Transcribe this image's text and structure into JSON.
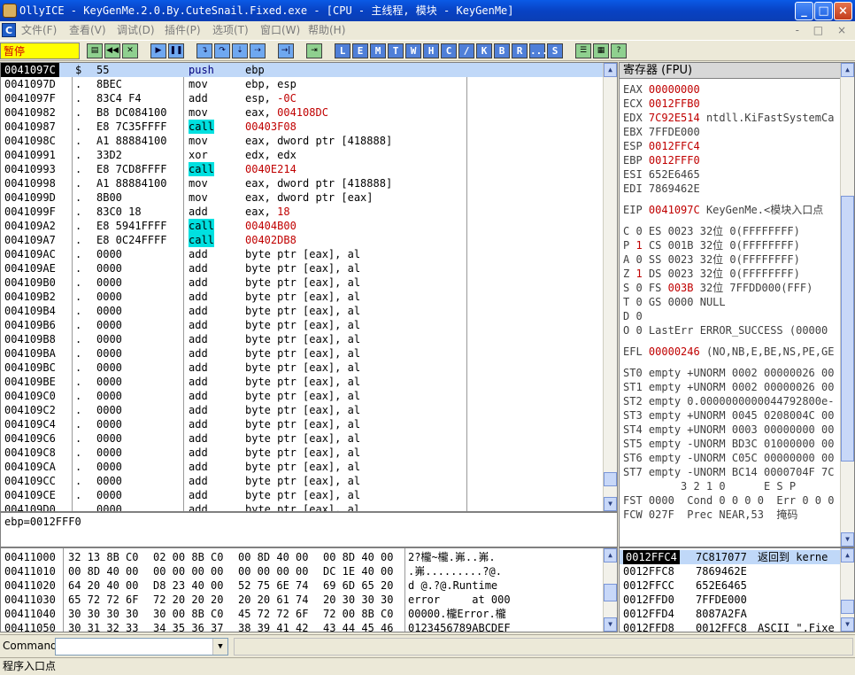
{
  "window": {
    "title": "OllyICE - KeyGenMe.2.0.By.CuteSnail.Fixed.exe - [CPU - 主线程, 模块 - KeyGenMe]",
    "controls": [
      "_",
      "□",
      "×"
    ]
  },
  "menu": {
    "icon": "C",
    "items": [
      "文件(F)",
      "查看(V)",
      "调试(D)",
      "插件(P)",
      "选项(T)",
      "窗口(W)",
      "帮助(H)"
    ],
    "mdi_controls": "- □ ×"
  },
  "toolbar": {
    "status": "暂停",
    "buttons": [
      "open",
      "rewind",
      "close",
      "run",
      "pause",
      "step-into",
      "step-over",
      "trace-into",
      "trace-over",
      "execute-till-return"
    ],
    "letters": [
      "L",
      "E",
      "M",
      "T",
      "W",
      "H",
      "C",
      "/",
      "K",
      "B",
      "R",
      "...",
      "S"
    ],
    "extra": [
      "list",
      "grid",
      "help"
    ],
    "help_label": "?"
  },
  "disasm": {
    "rows": [
      {
        "addr": "0041097C",
        "mark": "$",
        "hex": "55",
        "mn": "push",
        "op": "ebp",
        "sel": true
      },
      {
        "addr": "0041097D",
        "mark": ".",
        "hex": "8BEC",
        "mn": "mov",
        "op": "ebp, esp"
      },
      {
        "addr": "0041097F",
        "mark": ".",
        "hex": "83C4 F4",
        "mn": "add",
        "op": "esp, -0C",
        "opred": "-0C"
      },
      {
        "addr": "00410982",
        "mark": ".",
        "hex": "B8 DC084100",
        "mn": "mov",
        "op": "eax, 004108DC",
        "opred": "004108DC"
      },
      {
        "addr": "00410987",
        "mark": ".",
        "hex": "E8 7C35FFFF",
        "mn": "call",
        "op": "00403F08",
        "call": true
      },
      {
        "addr": "0041098C",
        "mark": ".",
        "hex": "A1 88884100",
        "mn": "mov",
        "op": "eax, dword ptr [418888]"
      },
      {
        "addr": "00410991",
        "mark": ".",
        "hex": "33D2",
        "mn": "xor",
        "op": "edx, edx"
      },
      {
        "addr": "00410993",
        "mark": ".",
        "hex": "E8 7CD8FFFF",
        "mn": "call",
        "op": "0040E214",
        "call": true
      },
      {
        "addr": "00410998",
        "mark": ".",
        "hex": "A1 88884100",
        "mn": "mov",
        "op": "eax, dword ptr [418888]"
      },
      {
        "addr": "0041099D",
        "mark": ".",
        "hex": "8B00",
        "mn": "mov",
        "op": "eax, dword ptr [eax]"
      },
      {
        "addr": "0041099F",
        "mark": ".",
        "hex": "83C0 18",
        "mn": "add",
        "op": "eax, 18",
        "opred": "18"
      },
      {
        "addr": "004109A2",
        "mark": ".",
        "hex": "E8 5941FFFF",
        "mn": "call",
        "op": "00404B00",
        "call": true
      },
      {
        "addr": "004109A7",
        "mark": ".",
        "hex": "E8 0C24FFFF",
        "mn": "call",
        "op": "00402DB8",
        "call": true
      },
      {
        "addr": "004109AC",
        "mark": ".",
        "hex": "0000",
        "mn": "add",
        "op": "byte ptr [eax], al"
      },
      {
        "addr": "004109AE",
        "mark": ".",
        "hex": "0000",
        "mn": "add",
        "op": "byte ptr [eax], al"
      },
      {
        "addr": "004109B0",
        "mark": ".",
        "hex": "0000",
        "mn": "add",
        "op": "byte ptr [eax], al"
      },
      {
        "addr": "004109B2",
        "mark": ".",
        "hex": "0000",
        "mn": "add",
        "op": "byte ptr [eax], al"
      },
      {
        "addr": "004109B4",
        "mark": ".",
        "hex": "0000",
        "mn": "add",
        "op": "byte ptr [eax], al"
      },
      {
        "addr": "004109B6",
        "mark": ".",
        "hex": "0000",
        "mn": "add",
        "op": "byte ptr [eax], al"
      },
      {
        "addr": "004109B8",
        "mark": ".",
        "hex": "0000",
        "mn": "add",
        "op": "byte ptr [eax], al"
      },
      {
        "addr": "004109BA",
        "mark": ".",
        "hex": "0000",
        "mn": "add",
        "op": "byte ptr [eax], al"
      },
      {
        "addr": "004109BC",
        "mark": ".",
        "hex": "0000",
        "mn": "add",
        "op": "byte ptr [eax], al"
      },
      {
        "addr": "004109BE",
        "mark": ".",
        "hex": "0000",
        "mn": "add",
        "op": "byte ptr [eax], al"
      },
      {
        "addr": "004109C0",
        "mark": ".",
        "hex": "0000",
        "mn": "add",
        "op": "byte ptr [eax], al"
      },
      {
        "addr": "004109C2",
        "mark": ".",
        "hex": "0000",
        "mn": "add",
        "op": "byte ptr [eax], al"
      },
      {
        "addr": "004109C4",
        "mark": ".",
        "hex": "0000",
        "mn": "add",
        "op": "byte ptr [eax], al"
      },
      {
        "addr": "004109C6",
        "mark": ".",
        "hex": "0000",
        "mn": "add",
        "op": "byte ptr [eax], al"
      },
      {
        "addr": "004109C8",
        "mark": ".",
        "hex": "0000",
        "mn": "add",
        "op": "byte ptr [eax], al"
      },
      {
        "addr": "004109CA",
        "mark": ".",
        "hex": "0000",
        "mn": "add",
        "op": "byte ptr [eax], al"
      },
      {
        "addr": "004109CC",
        "mark": ".",
        "hex": "0000",
        "mn": "add",
        "op": "byte ptr [eax], al"
      },
      {
        "addr": "004109CE",
        "mark": ".",
        "hex": "0000",
        "mn": "add",
        "op": "byte ptr [eax], al"
      },
      {
        "addr": "004109D0",
        "mark": ".",
        "hex": "0000",
        "mn": "add",
        "op": "byte ptr [eax], al"
      }
    ]
  },
  "info_text": "ebp=0012FFF0",
  "registers": {
    "header": "寄存器 (FPU)",
    "lines": [
      {
        "name": "EAX",
        "val": "00000000",
        "rest": "",
        "red": true
      },
      {
        "name": "ECX",
        "val": "0012FFB0",
        "rest": "",
        "red": true
      },
      {
        "name": "EDX",
        "val": "7C92E514",
        "rest": "ntdll.KiFastSystemCa",
        "red": true
      },
      {
        "name": "EBX",
        "val": "7FFDE000",
        "rest": "",
        "red": false
      },
      {
        "name": "ESP",
        "val": "0012FFC4",
        "rest": "",
        "red": true
      },
      {
        "name": "EBP",
        "val": "0012FFF0",
        "rest": "",
        "red": true
      },
      {
        "name": "ESI",
        "val": "652E6465",
        "rest": "",
        "red": false
      },
      {
        "name": "EDI",
        "val": "7869462E",
        "rest": "",
        "red": false
      },
      {
        "gap": true
      },
      {
        "name": "EIP",
        "val": "0041097C",
        "rest": "KeyGenMe.<模块入口点",
        "red": true
      },
      {
        "gap": true
      },
      {
        "name": "C 0",
        "val": "",
        "rest": "ES 0023 32位 0(FFFFFFFF)",
        "red": false
      },
      {
        "name": "P",
        "val": "1",
        "rest": "CS 001B 32位 0(FFFFFFFF)",
        "red": true
      },
      {
        "name": "A 0",
        "val": "",
        "rest": "SS 0023 32位 0(FFFFFFFF)",
        "red": false
      },
      {
        "name": "Z",
        "val": "1",
        "rest": "DS 0023 32位 0(FFFFFFFF)",
        "red": true
      },
      {
        "name": "S 0",
        "val": "",
        "rest": "FS 003B 32位 7FFDD000(FFF)",
        "red": false,
        "fsred": "003B"
      },
      {
        "name": "T 0",
        "val": "",
        "rest": "GS 0000 NULL",
        "red": false
      },
      {
        "name": "D 0",
        "val": "",
        "rest": "",
        "red": false
      },
      {
        "name": "O 0",
        "val": "",
        "rest": "LastErr ERROR_SUCCESS (00000",
        "red": false
      },
      {
        "gap": true
      },
      {
        "name": "EFL",
        "val": "00000246",
        "rest": "(NO,NB,E,BE,NS,PE,GE",
        "red": true
      },
      {
        "gap": true
      },
      {
        "name": "ST0",
        "val": "",
        "rest": "empty +UNORM 0002 00000026 00",
        "red": false
      },
      {
        "name": "ST1",
        "val": "",
        "rest": "empty +UNORM 0002 00000026 00",
        "red": false
      },
      {
        "name": "ST2",
        "val": "",
        "rest": "empty 0.0000000000044792800e-",
        "red": false
      },
      {
        "name": "ST3",
        "val": "",
        "rest": "empty +UNORM 0045 0208004C 00",
        "red": false
      },
      {
        "name": "ST4",
        "val": "",
        "rest": "empty +UNORM 0003 00000000 00",
        "red": false
      },
      {
        "name": "ST5",
        "val": "",
        "rest": "empty -UNORM BD3C 01000000 00",
        "red": false
      },
      {
        "name": "ST6",
        "val": "",
        "rest": "empty -UNORM C05C 00000000 00",
        "red": false
      },
      {
        "name": "ST7",
        "val": "",
        "rest": "empty -UNORM BC14 0000704F 7C",
        "red": false
      },
      {
        "name": "",
        "val": "",
        "rest": "        3 2 1 0      E S P",
        "red": false
      },
      {
        "name": "FST",
        "val": "",
        "rest": "0000  Cond 0 0 0 0  Err 0 0 0",
        "red": false
      },
      {
        "name": "FCW",
        "val": "",
        "rest": "027F  Prec NEAR,53  掩码",
        "red": false
      }
    ]
  },
  "dump": {
    "rows": [
      {
        "addr": "00411000",
        "b1": "32 13 8B C0",
        "b2": "02 00 8B C0",
        "b3": "00 8D 40 00",
        "b4": "00 8D 40 00",
        "ascii": "2?櫳~櫳.岪..岪."
      },
      {
        "addr": "00411010",
        "b1": "00 8D 40 00",
        "b2": "00 00 00 00",
        "b3": "00 00 00 00",
        "b4": "DC 1E 40 00",
        "ascii": ".岪.........?@."
      },
      {
        "addr": "00411020",
        "b1": "64 20 40 00",
        "b2": "D8 23 40 00",
        "b3": "52 75 6E 74",
        "b4": "69 6D 65 20",
        "ascii": "d @.?@.Runtime "
      },
      {
        "addr": "00411030",
        "b1": "65 72 72 6F",
        "b2": "72 20 20 20",
        "b3": "20 20 61 74",
        "b4": "20 30 30 30",
        "ascii": "error     at 000"
      },
      {
        "addr": "00411040",
        "b1": "30 30 30 30",
        "b2": "30 00 8B C0",
        "b3": "45 72 72 6F",
        "b4": "72 00 8B C0",
        "ascii": "00000.櫳Error.櫳"
      },
      {
        "addr": "00411050",
        "b1": "30 31 32 33",
        "b2": "34 35 36 37",
        "b3": "38 39 41 42",
        "b4": "43 44 45 46",
        "ascii": "0123456789ABCDEF"
      }
    ]
  },
  "stack": {
    "rows": [
      {
        "addr": "0012FFC4",
        "val": "7C817077",
        "cmt": "返回到 kerne",
        "sel": true
      },
      {
        "addr": "0012FFC8",
        "val": "7869462E",
        "cmt": ""
      },
      {
        "addr": "0012FFCC",
        "val": "652E6465",
        "cmt": ""
      },
      {
        "addr": "0012FFD0",
        "val": "7FFDE000",
        "cmt": ""
      },
      {
        "addr": "0012FFD4",
        "val": "8087A2FA",
        "cmt": ""
      },
      {
        "addr": "0012FFD8",
        "val": "0012FFC8",
        "cmt": "ASCII \".Fixe"
      }
    ]
  },
  "command": {
    "label": "Command",
    "value": ""
  },
  "status_text": "程序入口点"
}
